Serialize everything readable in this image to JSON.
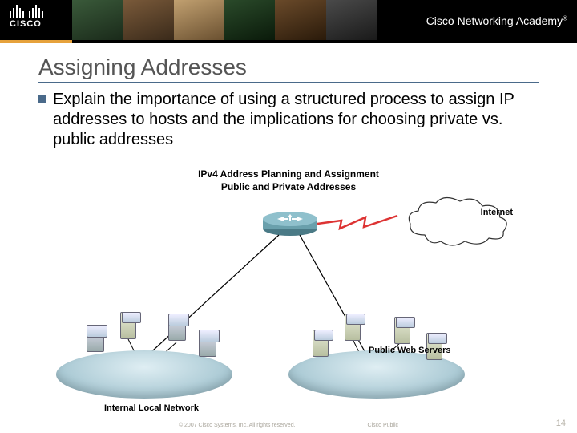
{
  "header": {
    "brand": "CISCO",
    "program": "Cisco Networking Academy",
    "tm": "®"
  },
  "slide": {
    "title": "Assigning Addresses",
    "bullet": "Explain the importance of using a structured process to assign IP addresses to hosts and the implications for choosing private vs. public addresses"
  },
  "diagram": {
    "title_line1": "IPv4 Address Planning and Assignment",
    "title_line2": "Public and Private Addresses",
    "internet_label": "Internet",
    "left_pool_label": "Internal Local Network",
    "right_pool_label": "Public Web Servers"
  },
  "footer": {
    "copyright": "© 2007 Cisco Systems, Inc. All rights reserved.",
    "classification": "Cisco Public",
    "page": "14"
  }
}
